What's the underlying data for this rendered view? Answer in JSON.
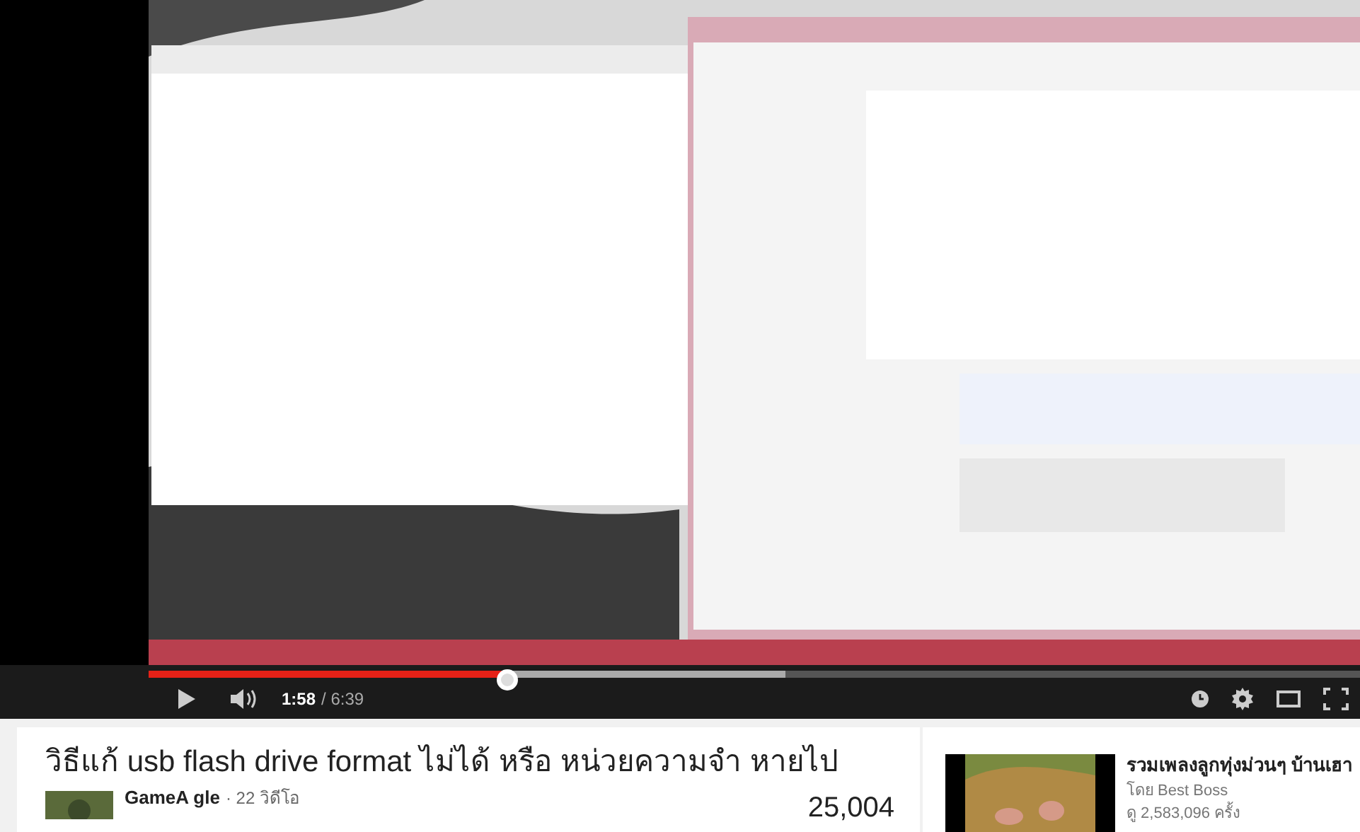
{
  "player": {
    "progress": {
      "level": 0.296
    },
    "time": {
      "current": "1:58",
      "duration": "/ 6:39"
    }
  },
  "video_info": {
    "title": "วิธีแก้ usb flash drive format ไม่ได้ หรือ หน่วยความจำ หายไป",
    "channel": "GameA gle",
    "video_count": "· 22 วิดีโอ",
    "views": "25,004"
  },
  "related": [
    {
      "title": "รวมเพลงลูกทุ่งม่วนๆ บ้านเฮา",
      "by": "โดย Best Boss",
      "views": "ดู 2,583,096 ครั้ง"
    }
  ]
}
